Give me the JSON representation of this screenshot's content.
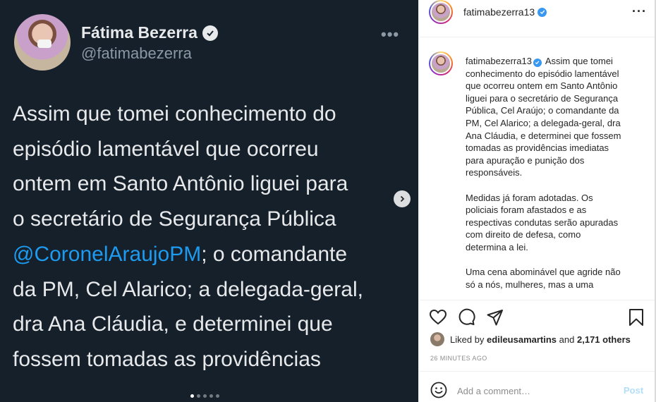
{
  "tweet": {
    "name": "Fátima Bezerra",
    "handle": "@fatimabezerra",
    "lines": [
      "Assim que tomei conhecimento do",
      "episódio lamentável que ocorreu",
      "ontem  em Santo Antônio liguei para",
      "o secretário de Segurança Pública",
      "",
      "da PM, Cel Alarico; a delegada-geral,",
      "dra Ana Cláudia, e determinei que",
      "fossem tomadas as providências"
    ],
    "mention": "@CoronelAraujoPM",
    "mention_tail": "; o comandante",
    "carousel_pages": 5,
    "carousel_active": 1
  },
  "post": {
    "username": "fatimabezerra13",
    "caption_user": "fatimabezerra13",
    "caption_lines": [
      "Assim que tomei",
      "conhecimento do episódio lamentável",
      "que ocorreu ontem em Santo Antônio",
      "liguei para o secretário de Segurança",
      "Pública, Cel Araújo; o comandante da",
      "PM, Cel Alarico; a delegada-geral, dra",
      "Ana Cláudia, e determinei que fossem",
      "tomadas as providências imediatas",
      "para apuração e punição dos",
      "responsáveis.",
      "",
      "Medidas já foram adotadas. Os",
      "policiais foram afastados e as",
      "respectivas condutas serão apuradas",
      "com direito de defesa, como",
      "determina a lei.",
      "",
      "Uma cena abominável que agride não",
      "só a nós, mulheres, mas a uma"
    ],
    "likes_prefix": "Liked by",
    "likes_user": "edileusamartins",
    "likes_and": "and",
    "likes_count": "2,171 others",
    "timestamp": "26 MINUTES AGO",
    "comment_placeholder": "Add a comment…",
    "post_label": "Post"
  },
  "colors": {
    "tweet_bg": "#15202b",
    "mention": "#1d9bf0",
    "ig_verified": "#3897f0",
    "post_disabled": "#b2dffc"
  },
  "icons": [
    "verified-badge-icon",
    "more-options-icon",
    "next-arrow-icon",
    "heart-icon",
    "comment-icon",
    "share-icon",
    "bookmark-icon",
    "emoji-icon"
  ]
}
